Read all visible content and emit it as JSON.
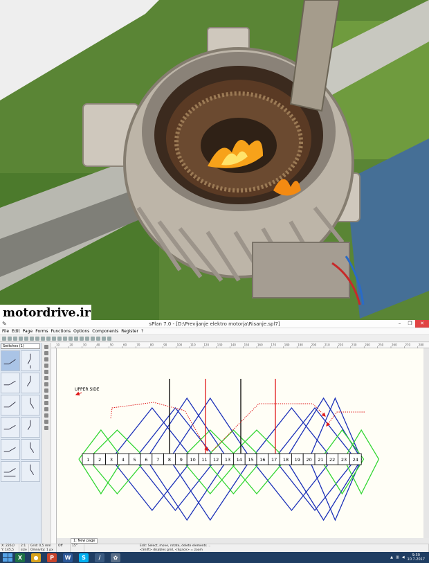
{
  "watermark": "motordrive.ir",
  "window": {
    "title": "sPlan 7.0 - [D:\\Previjanje elektro motorja\\Risanje.spl7]",
    "controls": [
      "–",
      "❐",
      "✕"
    ]
  },
  "menu": [
    "File",
    "Edit",
    "Page",
    "Forms",
    "Functions",
    "Options",
    "Components",
    "Register",
    "?"
  ],
  "library": {
    "selected": "Switches (1)"
  },
  "ruler_top": [
    "10",
    "20",
    "30",
    "40",
    "50",
    "60",
    "70",
    "80",
    "90",
    "100",
    "110",
    "120",
    "130",
    "140",
    "150",
    "160",
    "170",
    "180",
    "190",
    "200",
    "210",
    "220",
    "230",
    "240",
    "250",
    "260",
    "270",
    "280"
  ],
  "drawing": {
    "upper_side_label": "UPPER SIDE",
    "slots": [
      "1",
      "2",
      "3",
      "4",
      "5",
      "6",
      "7",
      "8",
      "9",
      "10",
      "11",
      "12",
      "13",
      "14",
      "15",
      "16",
      "17",
      "18",
      "19",
      "20",
      "21",
      "22",
      "23",
      "24"
    ],
    "colors": {
      "green": "#33d633",
      "blue": "#1a2fb8",
      "red": "#e01818",
      "black": "#000000"
    }
  },
  "pages": {
    "tab": "1: New page"
  },
  "status": {
    "coords": "X: 226,0\nY: 145,5",
    "zoom": "2:1\nsize",
    "grid": "Grid: 0,5 mm\nOmnivity: 1 px",
    "snap": "Off",
    "angle": "15°",
    "hint": "Edit: Select, move, rotate, delete elements ...\n<Shift> disables grid, <Space> = zoom"
  },
  "taskbar": {
    "apps": [
      {
        "name": "excel",
        "glyph": "X",
        "color": "#1e7145"
      },
      {
        "name": "chrome",
        "glyph": "●",
        "color": "#d8a21c"
      },
      {
        "name": "powerpoint",
        "glyph": "P",
        "color": "#c9442b"
      },
      {
        "name": "word",
        "glyph": "W",
        "color": "#2b5797"
      },
      {
        "name": "skype",
        "glyph": "S",
        "color": "#00aff0"
      },
      {
        "name": "splan",
        "glyph": "/",
        "color": "#3a5a80"
      },
      {
        "name": "app7",
        "glyph": "✿",
        "color": "#5a6e87"
      }
    ],
    "time": "9:30",
    "date": "10.7.2017"
  }
}
